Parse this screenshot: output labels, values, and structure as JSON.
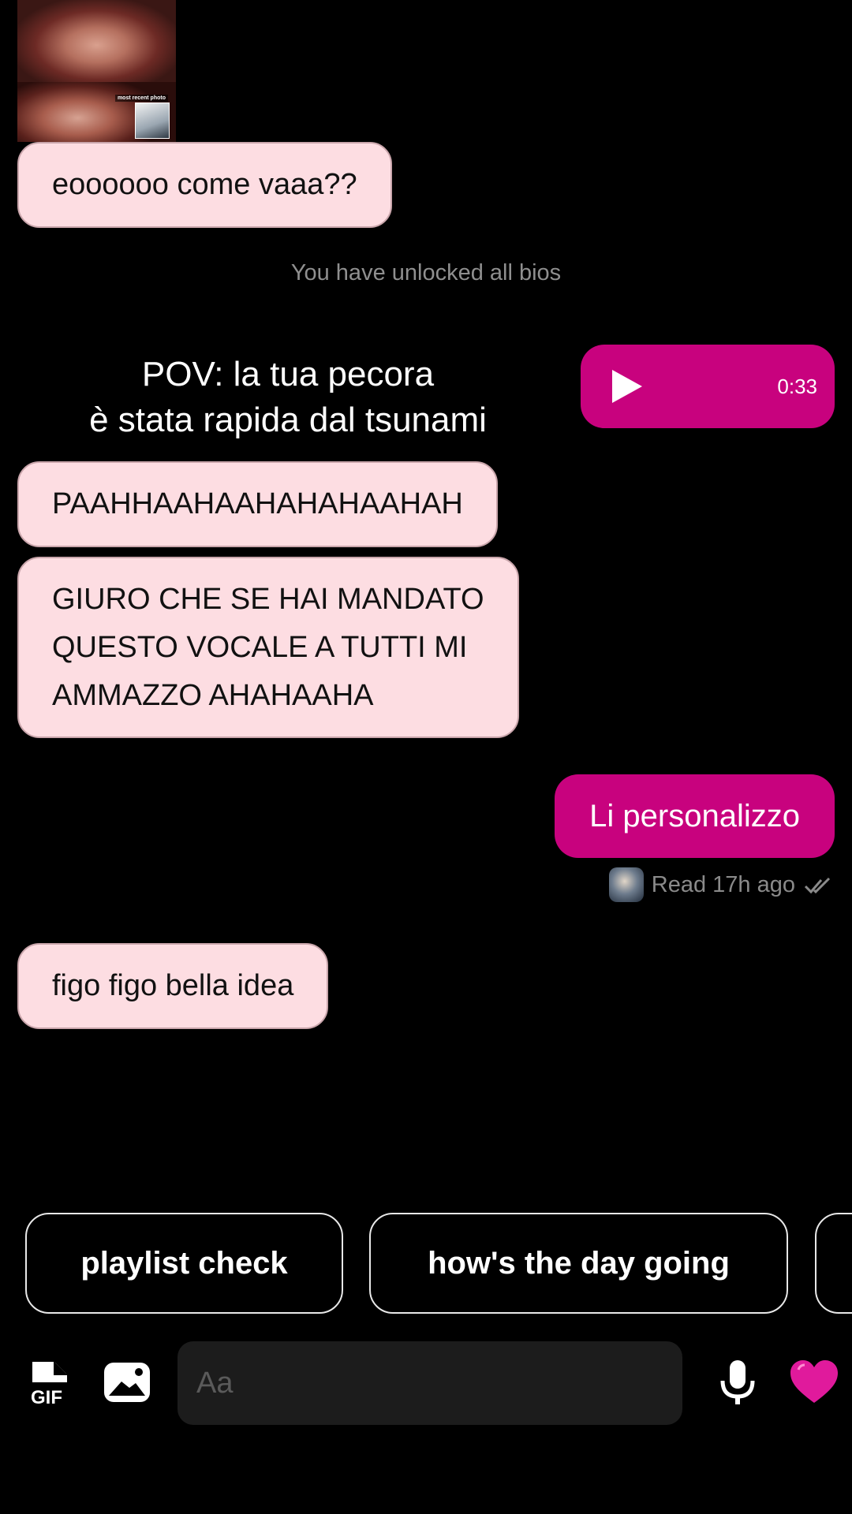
{
  "shared_photo": {
    "caption": "most recent photo"
  },
  "messages": {
    "m1": "eoooooo come vaaa??",
    "pov_line1": "POV: la tua pecora",
    "pov_line2": "è stata rapida dal tsunami",
    "m2": "PAAHHAAHAAHAHAHAAHAH",
    "m3_line1": "GIURO CHE SE HAI MANDATO",
    "m3_line2": "QUESTO VOCALE A TUTTI MI",
    "m3_line3": "AMMAZZO AHAHAAHA",
    "m_out": "Li personalizzo",
    "m4": "figo figo bella idea"
  },
  "system_note": "You have unlocked all bios",
  "voice_message": {
    "duration": "0:33"
  },
  "read_receipt": {
    "text": "Read 17h ago"
  },
  "suggestions": [
    "playlist check",
    "how's the day going"
  ],
  "composer": {
    "placeholder": "Aa",
    "gif_label": "GIF"
  },
  "colors": {
    "accent": "#c8027e",
    "incoming_bubble": "#fddde2",
    "background": "#000000"
  },
  "icons": [
    "gif-icon",
    "image-icon",
    "microphone-icon",
    "heart-icon",
    "play-icon",
    "double-check-icon"
  ]
}
